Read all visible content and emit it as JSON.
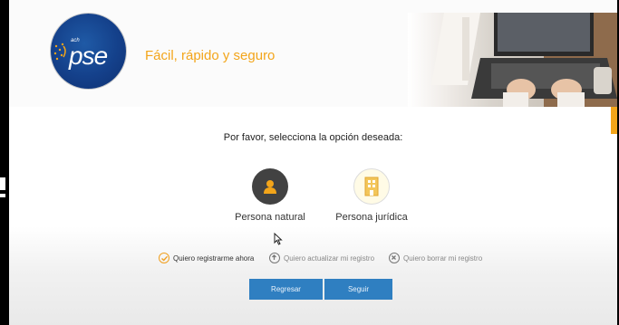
{
  "header": {
    "logo": {
      "small_text": "ach",
      "brand": "pse",
      "icon": "pse-logo"
    },
    "tagline": "Fácil, rápido y seguro",
    "photo": "laptop-typing-photo",
    "tagline_color": "#f3a51a"
  },
  "main": {
    "prompt": "Por favor, selecciona la opción deseada:",
    "options": [
      {
        "label": "Persona natural",
        "icon": "person-icon",
        "selected": true
      },
      {
        "label": "Persona jurídica",
        "icon": "building-icon",
        "selected": false
      }
    ],
    "radios": [
      {
        "label": "Quiero registrarme ahora",
        "icon": "check-circle-icon",
        "selected": true
      },
      {
        "label": "Quiero actualizar mi registro",
        "icon": "up-arrow-circle-icon",
        "selected": false
      },
      {
        "label": "Quiero borrar mi registro",
        "icon": "x-circle-icon",
        "selected": false
      }
    ],
    "buttons": {
      "back": "Regresar",
      "next": "Seguir"
    }
  },
  "colors": {
    "accent": "#f3a51a",
    "button": "#2f7fc1",
    "logo_blue": "#14408a"
  }
}
